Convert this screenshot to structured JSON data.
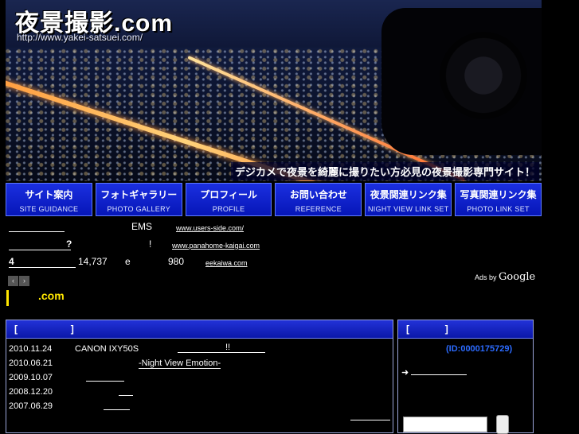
{
  "header": {
    "title": "夜景撮影.com",
    "url": "http://www.yakei-satsuei.com/",
    "catchphrase": "デジカメで夜景を綺麗に撮りたい方必見の夜景撮影専門サイト！"
  },
  "nav": [
    {
      "jp": "サイト案内",
      "en": "SITE GUIDANCE"
    },
    {
      "jp": "フォトギャラリー",
      "en": "PHOTO GALLERY"
    },
    {
      "jp": "プロフィール",
      "en": "PROFILE"
    },
    {
      "jp": "お問い合わせ",
      "en": "REFERENCE"
    },
    {
      "jp": "夜景関連リンク集",
      "en": "NIGHT VIEW LINK SET"
    },
    {
      "jp": "写真関連リンク集",
      "en": "PHOTO LINK SET"
    }
  ],
  "ads": {
    "row1": {
      "mid": "EMS",
      "url": "www.users-side.com/"
    },
    "row2": {
      "lead": "?",
      "mid": "!",
      "url": "www.panahome-kaigai.com"
    },
    "row3": {
      "lead": "4",
      "number": "14,737",
      "e": "e",
      "price": "980",
      "url": "eekaiwa.com"
    },
    "prev": "‹",
    "next": "›",
    "ads_by": "Ads by",
    "google": "Google"
  },
  "dotcom": ".com",
  "news": {
    "heading_open": "[",
    "heading_close": "]",
    "items": [
      {
        "date": "2010.11.24",
        "text": "CANON IXY50S",
        "tail": "!!"
      },
      {
        "date": "2010.06.21",
        "text": "-Night View Emotion-",
        "tail": ""
      },
      {
        "date": "2009.10.07",
        "text": "",
        "tail": ""
      },
      {
        "date": "2008.12.20",
        "text": "",
        "tail": ""
      },
      {
        "date": "2007.06.29",
        "text": "",
        "tail": ""
      }
    ]
  },
  "side": {
    "heading_open": "[",
    "heading_close": "]",
    "id_text": "(ID:0000175729)",
    "arrow": "➜"
  }
}
